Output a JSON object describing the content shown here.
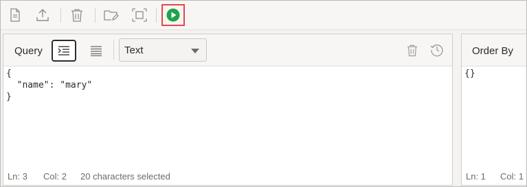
{
  "toolbar": {
    "icons": [
      "file-icon",
      "upload-icon",
      "trash-icon",
      "folder-edit-icon",
      "resize-icon",
      "run-icon"
    ],
    "accent_run": "#1ea34a",
    "highlight_border": "#e04848"
  },
  "query_panel": {
    "title": "Query",
    "mode_select": "Text",
    "editor_lines": [
      "{",
      "  \"name\": \"mary\"",
      "}"
    ],
    "status": {
      "line": "Ln: 3",
      "col": "Col: 2",
      "selection": "20 characters selected"
    }
  },
  "order_panel": {
    "title": "Order By",
    "editor_lines": [
      "{}"
    ],
    "status": {
      "line": "Ln: 1",
      "col": "Col: 1"
    }
  }
}
